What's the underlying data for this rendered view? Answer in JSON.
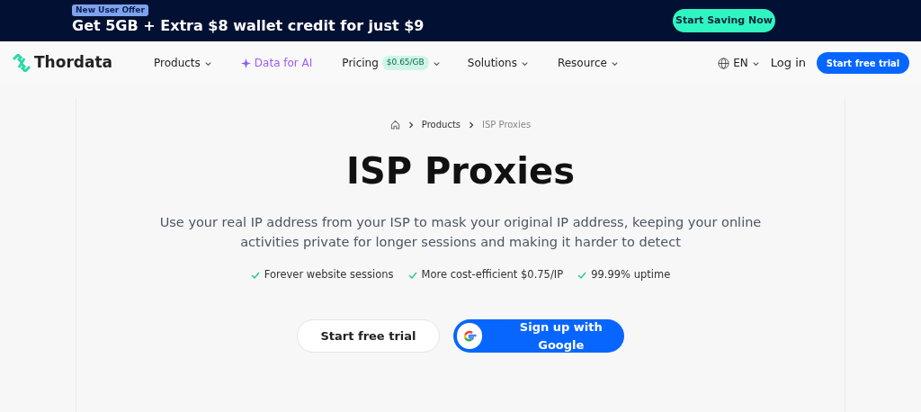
{
  "promo_banner": {
    "badge": "New User Offer",
    "headline": "Get 5GB + Extra $8 wallet credit for just $9",
    "button": "Start Saving Now"
  },
  "nav": {
    "logo": "Thordata",
    "items": [
      {
        "kind": "dropdown",
        "label": "Products"
      },
      {
        "kind": "ai",
        "label": "Data for AI"
      },
      {
        "kind": "pricing",
        "label": "Pricing",
        "badge": "$0.65/GB"
      },
      {
        "kind": "dropdown",
        "label": "Solutions"
      },
      {
        "kind": "dropdown",
        "label": "Resource"
      }
    ],
    "language": "EN",
    "login": "Log in",
    "cta": "Start free trial"
  },
  "breadcrumb": [
    "Products",
    "ISP Proxies"
  ],
  "hero": {
    "title": "ISP Proxies",
    "description": "Use your real IP address from your ISP to mask your original IP address, keeping your online activities private for longer sessions and making it harder to detect",
    "features": [
      "Forever website sessions",
      "More cost-efficient $0.75/IP",
      "99.99% uptime"
    ],
    "primary_button": "Start free trial",
    "google_button": "Sign up with Google"
  }
}
